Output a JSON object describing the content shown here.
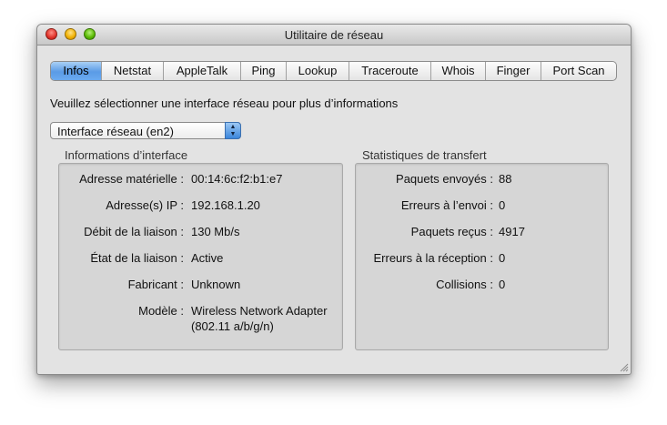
{
  "window": {
    "title": "Utilitaire de réseau"
  },
  "tabs": [
    {
      "label": "Infos",
      "active": true
    },
    {
      "label": "Netstat",
      "active": false
    },
    {
      "label": "AppleTalk",
      "active": false
    },
    {
      "label": "Ping",
      "active": false
    },
    {
      "label": "Lookup",
      "active": false
    },
    {
      "label": "Traceroute",
      "active": false
    },
    {
      "label": "Whois",
      "active": false
    },
    {
      "label": "Finger",
      "active": false
    },
    {
      "label": "Port Scan",
      "active": false
    }
  ],
  "prompt": "Veuillez sélectionner une interface réseau pour plus d’informations",
  "interface_select": {
    "value": "Interface réseau (en2)"
  },
  "interface_info": {
    "title": "Informations d’interface",
    "rows": [
      {
        "label": "Adresse matérielle :",
        "value": "00:14:6c:f2:b1:e7"
      },
      {
        "label": "Adresse(s) IP :",
        "value": "192.168.1.20"
      },
      {
        "label": "Débit de la liaison :",
        "value": "130 Mb/s"
      },
      {
        "label": "État de la liaison :",
        "value": "Active"
      },
      {
        "label": "Fabricant :",
        "value": "Unknown"
      },
      {
        "label": "Modèle :",
        "value": "Wireless Network Adapter",
        "value2": "(802.11 a/b/g/n)"
      }
    ]
  },
  "transfer_stats": {
    "title": "Statistiques de transfert",
    "rows": [
      {
        "label": "Paquets envoyés :",
        "value": "88"
      },
      {
        "label": "Erreurs à l’envoi :",
        "value": "0"
      },
      {
        "label": "Paquets reçus :",
        "value": "4917"
      },
      {
        "label": "Erreurs à la réception :",
        "value": "0"
      },
      {
        "label": "Collisions :",
        "value": "0"
      }
    ]
  },
  "colors": {
    "accent": "#5a9be6",
    "window_bg": "#e3e3e3",
    "box_bg": "#d6d6d6"
  }
}
